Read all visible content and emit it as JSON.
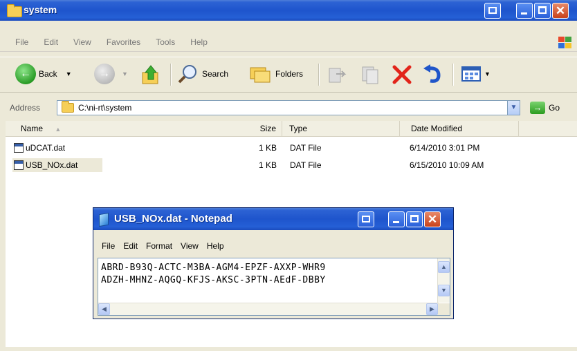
{
  "explorer": {
    "title": "system",
    "menu": [
      "File",
      "Edit",
      "View",
      "Favorites",
      "Tools",
      "Help"
    ],
    "toolbar": {
      "back_label": "Back",
      "search_label": "Search",
      "folders_label": "Folders"
    },
    "address": {
      "label": "Address",
      "value": "C:\\ni-rt\\system",
      "go_label": "Go"
    },
    "columns": [
      "Name",
      "Size",
      "Type",
      "Date Modified"
    ],
    "files": [
      {
        "name": "uDCAT.dat",
        "size": "1 KB",
        "type": "DAT File",
        "modified": "6/14/2010 3:01 PM"
      },
      {
        "name": "USB_NOx.dat",
        "size": "1 KB",
        "type": "DAT File",
        "modified": "6/15/2010 10:09 AM"
      }
    ]
  },
  "notepad": {
    "title": "USB_NOx.dat - Notepad",
    "menu": [
      "File",
      "Edit",
      "Format",
      "View",
      "Help"
    ],
    "lines": [
      "ABRD-B93Q-ACTC-M3BA-AGM4-EPZF-AXXP-WHR9",
      "ADZH-MHNZ-AQGQ-KFJS-AKSC-3PTN-AEdF-DBBY"
    ]
  },
  "colors": {
    "titlebar": "#2d63d4",
    "close_button": "#c8421b",
    "window_face": "#ece9d8",
    "selected_row": "#ece9d8"
  }
}
